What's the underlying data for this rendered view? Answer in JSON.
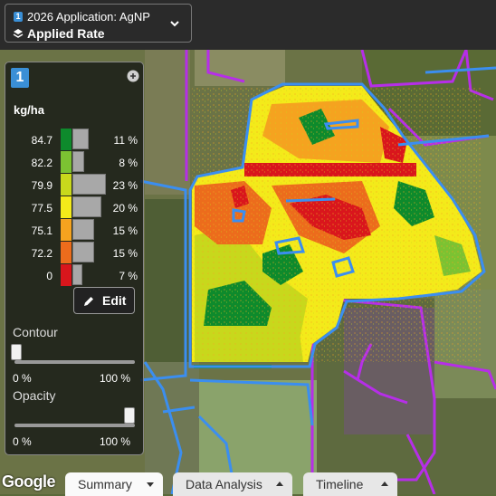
{
  "layer_selector": {
    "badge": "1",
    "application": "2026 Application: AgNP",
    "rate": "Applied Rate"
  },
  "legend": {
    "badge": "1",
    "unit": "kg/ha",
    "rows": [
      {
        "value": "84.7",
        "percent": "11 %",
        "share": 11,
        "color": "#0e8a2c"
      },
      {
        "value": "82.2",
        "percent": "8 %",
        "share": 8,
        "color": "#7cc232"
      },
      {
        "value": "79.9",
        "percent": "23 %",
        "share": 23,
        "color": "#c8d81c"
      },
      {
        "value": "77.5",
        "percent": "20 %",
        "share": 20,
        "color": "#f4ea1a"
      },
      {
        "value": "75.1",
        "percent": "15 %",
        "share": 15,
        "color": "#f5a31f"
      },
      {
        "value": "72.2",
        "percent": "15 %",
        "share": 15,
        "color": "#ec6c1c"
      },
      {
        "value": "0",
        "percent": "7 %",
        "share": 7,
        "color": "#d9161c"
      }
    ],
    "edit_label": "Edit"
  },
  "contour": {
    "title": "Contour",
    "min": "0 %",
    "max": "100 %",
    "value": 0
  },
  "opacity": {
    "title": "Opacity",
    "min": "0 %",
    "max": "100 %",
    "value": 100
  },
  "map": {
    "attribution": "Google"
  },
  "tabs": [
    {
      "label": "Summary",
      "active": true
    },
    {
      "label": "Data Analysis",
      "active": false
    },
    {
      "label": "Timeline",
      "active": false
    }
  ],
  "colors": {
    "field_boundary": "#3b8ef0",
    "other_boundary": "#b62ee8",
    "accent": "#3a8fd6"
  }
}
